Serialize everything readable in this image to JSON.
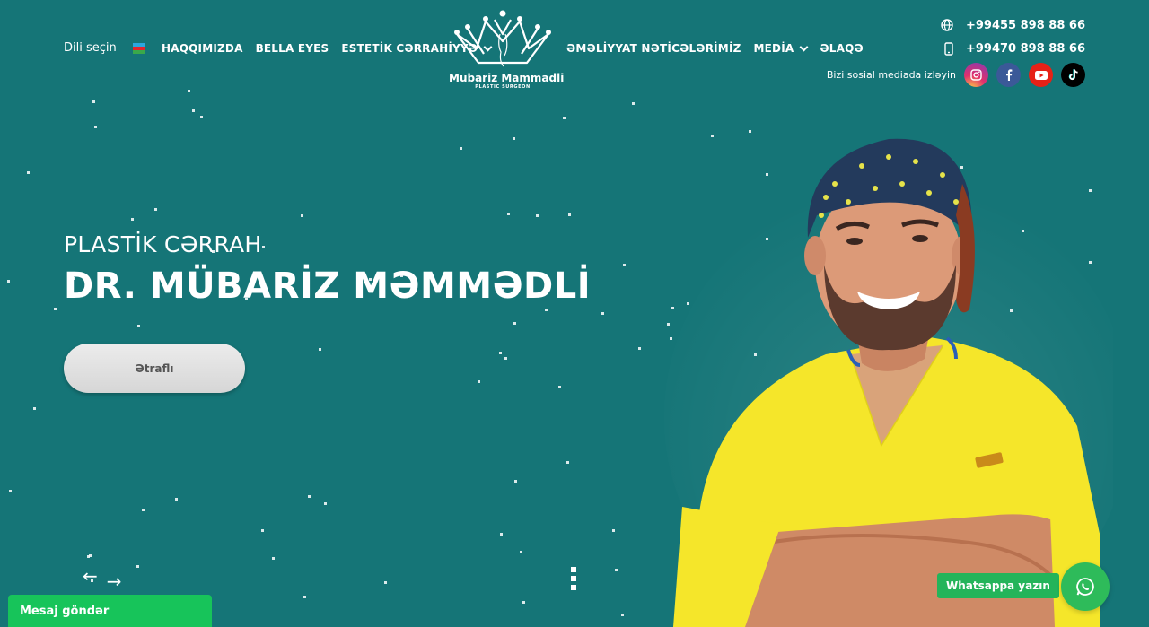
{
  "header": {
    "language_label": "Dili seçin",
    "language_flag": "azerbaijan-flag",
    "nav_left": [
      {
        "label": "HAQQIMIZDA",
        "dropdown": false
      },
      {
        "label": "BELLA EYES",
        "dropdown": false
      },
      {
        "label": "ESTETİK CƏRRAHİYYƏ",
        "dropdown": true
      }
    ],
    "nav_right": [
      {
        "label": "ƏMƏLİYYAT NƏTİCƏLƏRİMİZ",
        "dropdown": false
      },
      {
        "label": "MEDİA",
        "dropdown": true
      },
      {
        "label": "ƏLAQƏ",
        "dropdown": false
      }
    ],
    "logo": {
      "name": "Mubariz Mammadli",
      "subtitle": "PLASTIC SURGEON",
      "icon": "crown-icon"
    },
    "phones": [
      {
        "number": "+99455 898 88 66",
        "icon": "globe-icon"
      },
      {
        "number": "+99470 898 88 66",
        "icon": "mobile-phone-icon"
      }
    ],
    "social_label": "Bizi sosial mediada izləyin",
    "socials": [
      {
        "name": "instagram",
        "icon": "instagram-icon",
        "color": "#e1306c"
      },
      {
        "name": "facebook",
        "icon": "facebook-icon",
        "color": "#3b5998"
      },
      {
        "name": "youtube",
        "icon": "youtube-icon",
        "color": "#e62117"
      },
      {
        "name": "tiktok",
        "icon": "tiktok-icon",
        "color": "#000000"
      }
    ]
  },
  "hero": {
    "subtitle": "PLASTİK CƏRRAH",
    "title": "DR. MÜBARİZ MƏMMƏDLİ",
    "button_label": "Ətraflı",
    "prev_arrow": "←",
    "next_arrow": "→"
  },
  "widgets": {
    "whatsapp_label": "Whatsappa yazın",
    "message_bar": "Mesaj göndər"
  },
  "colors": {
    "background": "#157577",
    "whatsapp": "#2ebb5a",
    "message_bar": "#17c45a",
    "scrubs": "#f5e62a"
  }
}
